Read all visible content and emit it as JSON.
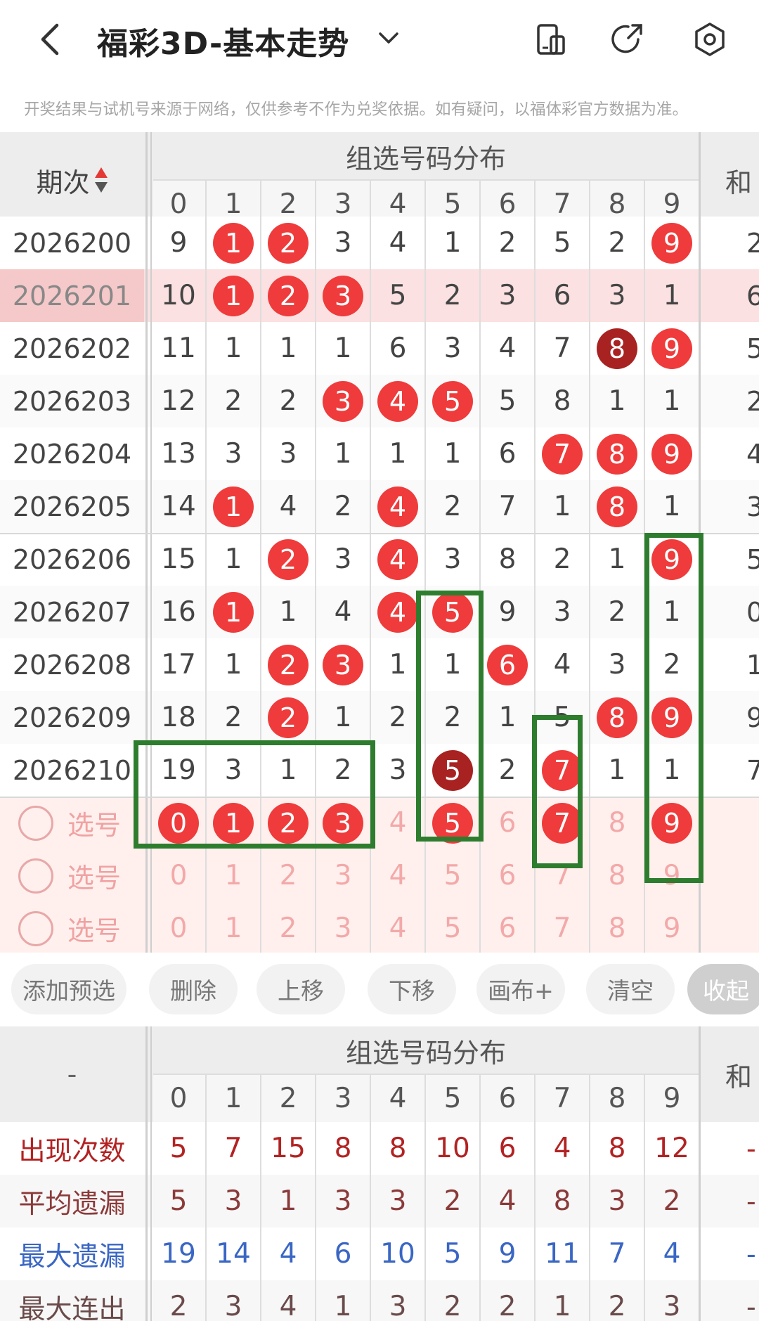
{
  "header": {
    "title": "福彩3D-基本走势",
    "disclaimer": "开奖结果与试机号来源于网络，仅供参考不作为兑奖依据。如有疑问，以福体彩官方数据为准。"
  },
  "icons": [
    "back-icon",
    "dropdown-chevron-icon",
    "layout-icon",
    "share-icon",
    "settings-icon"
  ],
  "table": {
    "issue_header": "期次",
    "group_title": "组选号码分布",
    "sum_header": "和",
    "digits": [
      "0",
      "1",
      "2",
      "3",
      "4",
      "5",
      "6",
      "7",
      "8",
      "9"
    ],
    "rows": [
      {
        "issue": "2026200",
        "cells": [
          "9",
          "1",
          "2",
          "3",
          "4",
          "1",
          "2",
          "5",
          "2",
          "9"
        ],
        "balls": [
          1,
          2,
          9
        ],
        "dark": [],
        "sum": "2"
      },
      {
        "issue": "2026201",
        "cells": [
          "10",
          "1",
          "2",
          "3",
          "5",
          "2",
          "3",
          "6",
          "3",
          "1"
        ],
        "balls": [
          1,
          2,
          3
        ],
        "dark": [],
        "sum": "6"
      },
      {
        "issue": "2026202",
        "cells": [
          "11",
          "1",
          "1",
          "1",
          "6",
          "3",
          "4",
          "7",
          "8",
          "9"
        ],
        "balls": [
          8,
          9
        ],
        "dark": [
          8
        ],
        "sum": "5"
      },
      {
        "issue": "2026203",
        "cells": [
          "12",
          "2",
          "2",
          "3",
          "4",
          "5",
          "5",
          "8",
          "1",
          "1"
        ],
        "balls": [
          3,
          4,
          5
        ],
        "dark": [],
        "sum": "2"
      },
      {
        "issue": "2026204",
        "cells": [
          "13",
          "3",
          "3",
          "1",
          "1",
          "1",
          "6",
          "7",
          "8",
          "9"
        ],
        "balls": [
          7,
          8,
          9
        ],
        "dark": [],
        "sum": "4"
      },
      {
        "issue": "2026205",
        "cells": [
          "14",
          "1",
          "4",
          "2",
          "4",
          "2",
          "7",
          "1",
          "8",
          "1"
        ],
        "balls": [
          1,
          4,
          8
        ],
        "dark": [],
        "sum": "3"
      },
      {
        "issue": "2026206",
        "cells": [
          "15",
          "1",
          "2",
          "3",
          "4",
          "3",
          "8",
          "2",
          "1",
          "9"
        ],
        "balls": [
          2,
          4,
          9
        ],
        "dark": [],
        "sum": "5"
      },
      {
        "issue": "2026207",
        "cells": [
          "16",
          "1",
          "1",
          "4",
          "4",
          "5",
          "9",
          "3",
          "2",
          "1"
        ],
        "balls": [
          1,
          4,
          5
        ],
        "dark": [],
        "sum": "0"
      },
      {
        "issue": "2026208",
        "cells": [
          "17",
          "1",
          "2",
          "3",
          "1",
          "1",
          "6",
          "4",
          "3",
          "2"
        ],
        "balls": [
          2,
          3,
          6
        ],
        "dark": [],
        "sum": "1"
      },
      {
        "issue": "2026209",
        "cells": [
          "18",
          "2",
          "2",
          "1",
          "2",
          "2",
          "1",
          "5",
          "8",
          "9"
        ],
        "balls": [
          2,
          8,
          9
        ],
        "dark": [],
        "sum": "9"
      },
      {
        "issue": "2026210",
        "cells": [
          "19",
          "3",
          "1",
          "2",
          "3",
          "5",
          "2",
          "7",
          "1",
          "1"
        ],
        "balls": [
          5,
          7
        ],
        "dark": [
          5
        ],
        "sum": "7"
      }
    ],
    "pick_label": "选号",
    "pick_rows": [
      {
        "selected": [
          0,
          1,
          2,
          3,
          5,
          7,
          9
        ]
      },
      {
        "selected": []
      },
      {
        "selected": []
      }
    ]
  },
  "buttons": [
    "添加预选",
    "删除",
    "上移",
    "下移",
    "画布+",
    "清空",
    "收起"
  ],
  "stats": {
    "corner": "-",
    "group_title": "组选号码分布",
    "sum_header": "和",
    "rows": [
      {
        "label": "出现次数",
        "values": [
          "5",
          "7",
          "15",
          "8",
          "8",
          "10",
          "6",
          "4",
          "8",
          "12"
        ],
        "color": "#b22222",
        "sum": "-"
      },
      {
        "label": "平均遗漏",
        "values": [
          "5",
          "3",
          "1",
          "3",
          "3",
          "2",
          "4",
          "8",
          "3",
          "2"
        ],
        "color": "#8b3a3a",
        "sum": "-"
      },
      {
        "label": "最大遗漏",
        "values": [
          "19",
          "14",
          "4",
          "6",
          "10",
          "5",
          "9",
          "11",
          "7",
          "4"
        ],
        "color": "#3a66c4",
        "sum": "-"
      },
      {
        "label": "最大连出",
        "values": [
          "2",
          "3",
          "4",
          "1",
          "3",
          "2",
          "2",
          "1",
          "2",
          "3"
        ],
        "color": "#6a4a4a",
        "sum": "-"
      }
    ]
  },
  "colors": {
    "ball": "#ef3b3b",
    "ball_dark": "#a82222",
    "highlight_row": "#fbe1e1",
    "pick_bg": "#fff0ee",
    "box": "#2e7d2e"
  }
}
